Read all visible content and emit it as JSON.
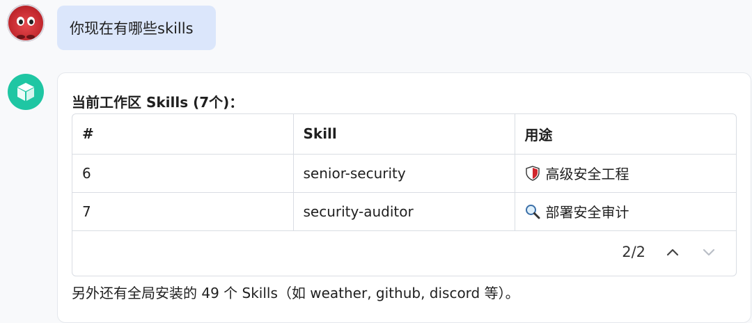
{
  "user_message": {
    "text": "你现在有哪些skills"
  },
  "assistant": {
    "heading": "当前工作区 Skills (7个)：",
    "table": {
      "headers": [
        "#",
        "Skill",
        "用途"
      ],
      "rows": [
        {
          "index": "6",
          "skill": "senior-security",
          "usage": "高级安全工程",
          "icon": "shield-icon"
        },
        {
          "index": "7",
          "skill": "security-auditor",
          "usage": "部署安全审计",
          "icon": "magnifier-icon"
        }
      ],
      "pagination": {
        "text": "2/2",
        "prev_icon": "chevron-up-icon",
        "next_icon": "chevron-down-icon"
      }
    },
    "footer": "另外还有全局安装的 49 个 Skills（如 weather, github, discord 等）。"
  },
  "colors": {
    "user_bubble": "#dbe6fb",
    "bot_avatar": "#1fc6a3",
    "user_avatar": "#c1272d"
  }
}
